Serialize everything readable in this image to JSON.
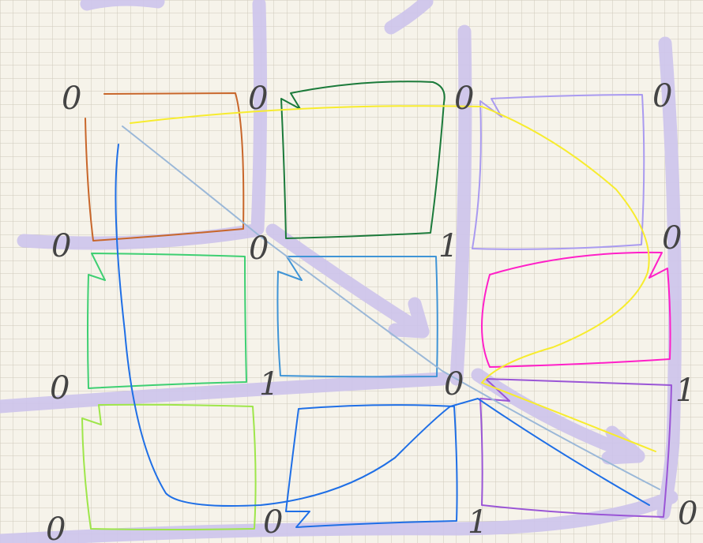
{
  "figure": {
    "background_color": "#f6f3ea",
    "grid_color": "#cfcabb",
    "highlight_color": "#cdc4ec",
    "labels": {
      "r0c0": "0",
      "r0c1": "0",
      "r0c2": "0",
      "r0c3": "0",
      "r1c0": "0",
      "r1c1": "0",
      "r1c2": "1",
      "r1c3": "0",
      "r2c0": "0",
      "r2c1": "1",
      "r2c2": "0",
      "r2c3": "1",
      "r3c0": "0",
      "r3c1": "0",
      "r3c2": "1",
      "r3c3": "0"
    },
    "region_colors": {
      "orange": "#c8662a",
      "dark_green": "#1b7a3a",
      "lavender": "#a99af0",
      "green": "#3ecf72",
      "sky_blue": "#3f94d6",
      "magenta": "#ff1fc8",
      "lime": "#9ee64a",
      "blue": "#1f6fe6",
      "purple": "#9a55d6"
    },
    "path_colors": {
      "yellow": "#f7ec2e",
      "blue": "#1f6fe6",
      "light_blue": "#9bb8d8"
    }
  }
}
